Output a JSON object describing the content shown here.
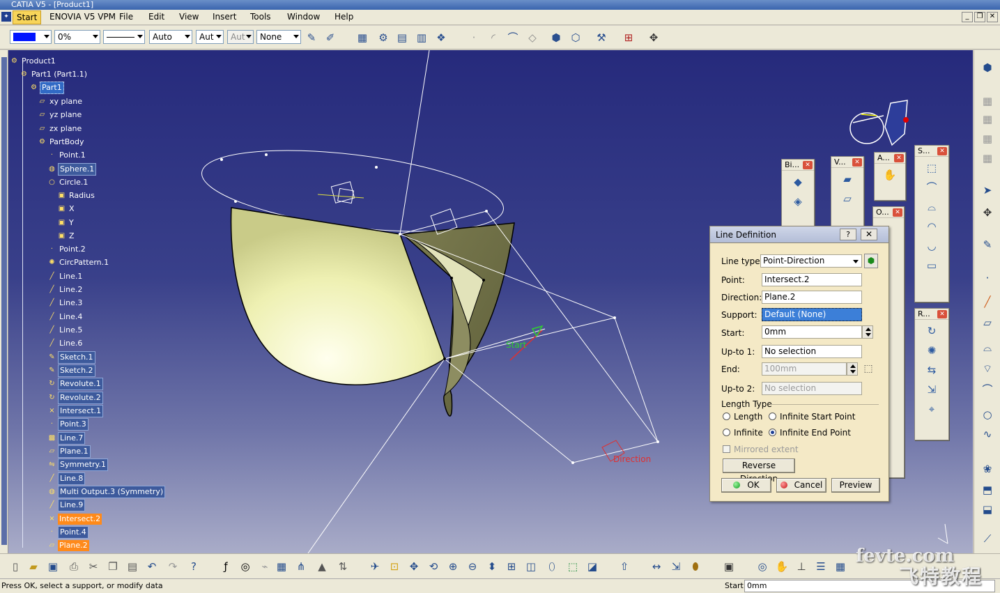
{
  "window": {
    "title": "CATIA V5 - [Product1]"
  },
  "menu": [
    "Start",
    "ENOVIA V5 VPM",
    "File",
    "Edit",
    "View",
    "Insert",
    "Tools",
    "Window",
    "Help"
  ],
  "toolbar_top": {
    "color_combo": "",
    "transparency": "0%",
    "line_style": "",
    "thickness": "Auto",
    "point_style": "Aut",
    "layer_style": "Aut",
    "layer": "None"
  },
  "tree": {
    "root": "Product1",
    "part_instance": "Part1 (Part1.1)",
    "part": "Part1",
    "planes": [
      "xy plane",
      "yz plane",
      "zx plane"
    ],
    "body": "PartBody",
    "features": [
      "Point.1",
      "Sphere.1",
      "Circle.1",
      "Radius",
      "X",
      "Y",
      "Z",
      "Point.2",
      "CircPattern.1",
      "Line.1",
      "Line.2",
      "Line.3",
      "Line.4",
      "Line.5",
      "Line.6",
      "Sketch.1",
      "Sketch.2",
      "Revolute.1",
      "Revolute.2",
      "Intersect.1",
      "Point.3",
      "Line.7",
      "Plane.1",
      "Symmetry.1",
      "Line.8",
      "Multi Output.3 (Symmetry)",
      "Line.9",
      "Intersect.2",
      "Point.4",
      "Plane.2"
    ]
  },
  "viewport_labels": {
    "start": "Start",
    "direction": "Direction"
  },
  "floating_toolbars": [
    "Bi...",
    "V...",
    "A...",
    "S...",
    "O...",
    "R..."
  ],
  "dialog": {
    "title": "Line Definition",
    "help": "?",
    "close": "✕",
    "line_type_label": "Line type :",
    "line_type_value": "Point-Direction",
    "point_label": "Point:",
    "point_value": "Intersect.2",
    "direction_label": "Direction:",
    "direction_value": "Plane.2",
    "support_label": "Support:",
    "support_value": "Default (None)",
    "start_label": "Start:",
    "start_value": "0mm",
    "upto1_label": "Up-to 1:",
    "upto1_value": "No selection",
    "end_label": "End:",
    "end_value": "100mm",
    "upto2_label": "Up-to 2:",
    "upto2_value": "No selection",
    "length_type_label": "Length Type",
    "length_options": [
      "Length",
      "Infinite Start Point",
      "Infinite",
      "Infinite End Point"
    ],
    "length_selected": "Infinite End Point",
    "mirrored_extent": "Mirrored extent",
    "reverse_direction": "Reverse Direction",
    "ok": "OK",
    "cancel": "Cancel",
    "preview": "Preview"
  },
  "status": {
    "message": "Press OK, select a support, or modify data",
    "field_label": "Start",
    "field_value": "0mm"
  },
  "watermark": {
    "line1": "fevte.com",
    "line2": "飞特教程网"
  },
  "colors": {
    "viewport_top": "#262a7c",
    "dialog_bg": "#f4e9c6",
    "highlight_orange": "#ff8a1a",
    "selection_blue": "#316ac5"
  }
}
